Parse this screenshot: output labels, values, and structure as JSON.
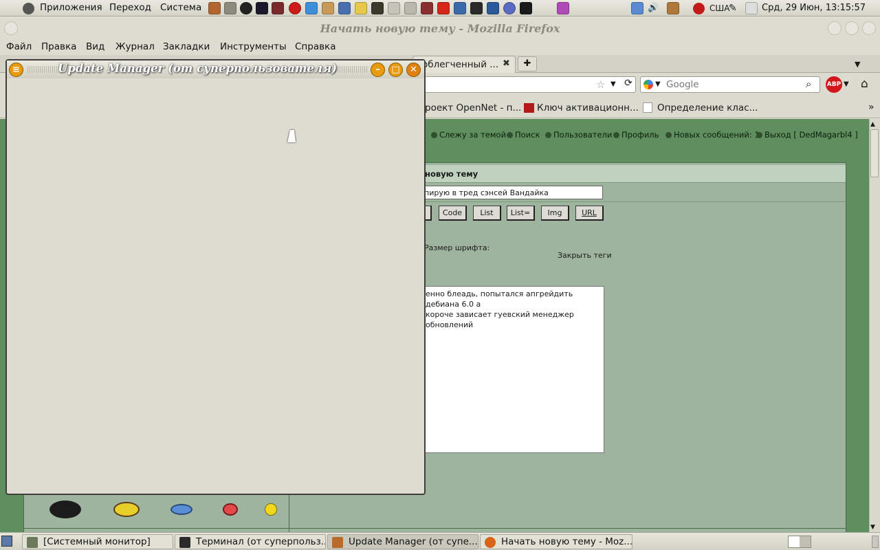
{
  "top_panel": {
    "menus": [
      "Приложения",
      "Переход",
      "Система"
    ],
    "tray": {
      "layout": "США",
      "datetime": "Срд, 29 Июн, 13:15:57"
    }
  },
  "firefox": {
    "title": "Начать новую тему - Mozilla Firefox",
    "menu": [
      "Файл",
      "Правка",
      "Вид",
      "Журнал",
      "Закладки",
      "Инструменты",
      "Справка"
    ],
    "tab_title": "облегченный ...",
    "tab_close": "✖",
    "new_tab": "✚",
    "search_placeholder": "Google",
    "abp": "ABP",
    "bookmarks": [
      "роект OpenNet - п...",
      "Ключ активационн...",
      "Определение клас..."
    ],
    "bookmarks_more": "»"
  },
  "forum": {
    "nav": [
      "Слежу за темой",
      "Поиск",
      "Пользователи",
      "Профиль",
      "Новых сообщений: 1",
      "Выход [ DedMagarbl4 ]"
    ],
    "header": "новую тему",
    "subject": "пирую в тред сэнсей Вандайка",
    "bbcode": [
      "Code",
      "List",
      "List=",
      "Img",
      "URL"
    ],
    "font_size_label": "Размер шрифта:",
    "close_tags": "Закрыть теги",
    "message_lines": [
      "енно блеадь, попытался апгрейдить дебиана 6.0 а",
      "короче зависает гуевский менеджер обновлений"
    ]
  },
  "update_manager": {
    "title": "Update Manager (от суперпользователя)"
  },
  "taskbar": [
    {
      "label": "[Системный монитор]",
      "icon_color": "#6b7a5a"
    },
    {
      "label": "Терминал (от суперпольз...",
      "icon_color": "#2b2b2b"
    },
    {
      "label": "Update Manager (от супе...",
      "icon_color": "#b86b2a"
    },
    {
      "label": "Начать новую тему - Moz...",
      "icon_color": "#d8641a"
    }
  ],
  "colors": {
    "forum_bg": "#5f8e5f",
    "panel": "#9eb49e",
    "um_window": "#dedcd0",
    "accent": "#e08a10"
  }
}
